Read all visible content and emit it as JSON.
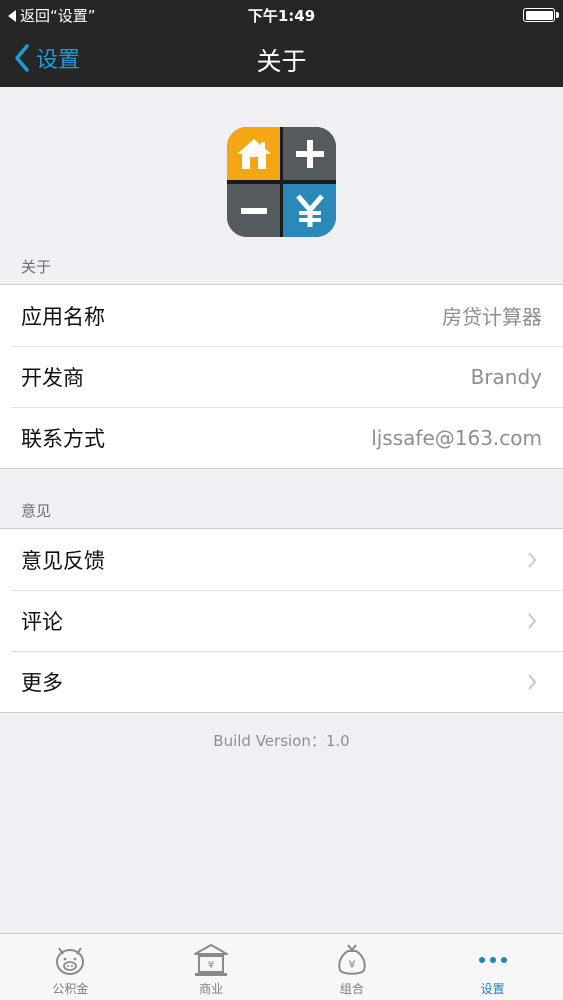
{
  "status_bar": {
    "back_label": "返回“设置”",
    "time": "下午1:49"
  },
  "nav": {
    "back_label": "设置",
    "title": "关于"
  },
  "about_section": {
    "header": "关于",
    "rows": [
      {
        "label": "应用名称",
        "value": "房贷计算器"
      },
      {
        "label": "开发商",
        "value": "Brandy"
      },
      {
        "label": "联系方式",
        "value": "ljssafe@163.com"
      }
    ]
  },
  "feedback_section": {
    "header": "意见",
    "rows": [
      {
        "label": "意见反馈"
      },
      {
        "label": "评论"
      },
      {
        "label": "更多"
      }
    ]
  },
  "build_version": "Build Version：1.0",
  "tabs": [
    {
      "label": "公积金",
      "icon": "pig-icon"
    },
    {
      "label": "商业",
      "icon": "bank-icon"
    },
    {
      "label": "组合",
      "icon": "money-bag-icon"
    },
    {
      "label": "设置",
      "icon": "more-dots-icon",
      "active": true
    }
  ],
  "colors": {
    "accent": "#1d9bd8",
    "bar_background": "#262626",
    "page_background": "#efeff4",
    "icon_orange": "#f5a713",
    "icon_gray": "#555a5e",
    "icon_blue": "#2a89b8"
  }
}
